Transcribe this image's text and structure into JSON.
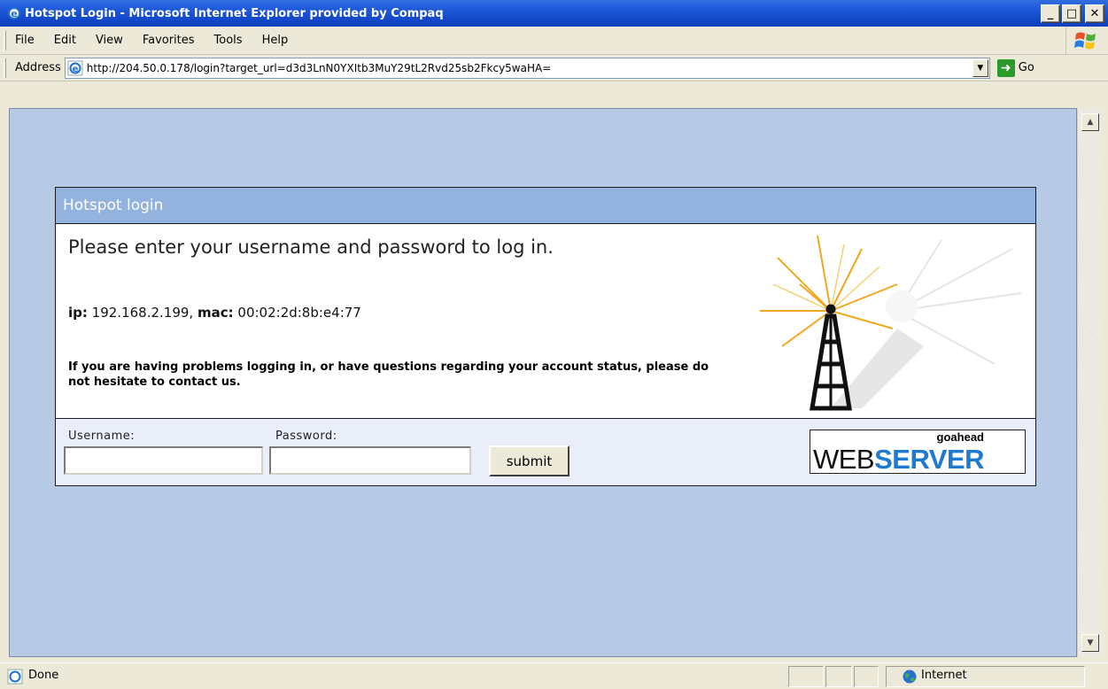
{
  "window": {
    "title": "Hotspot Login - Microsoft Internet Explorer provided by Compaq",
    "buttons": {
      "minimize": "_",
      "maximize": "□",
      "close": "✕"
    }
  },
  "menu": {
    "items": [
      "File",
      "Edit",
      "View",
      "Favorites",
      "Tools",
      "Help"
    ]
  },
  "address": {
    "label": "Address",
    "url": "http://204.50.0.178/login?target_url=d3d3LnN0YXItb3MuY29tL2Rvd25sb2Fkcy5waHA=",
    "go_label": "Go"
  },
  "page": {
    "panel_title": "Hotspot login",
    "prompt": "Please enter your username and password to log in.",
    "ip_label": "ip:",
    "ip_value": "192.168.2.199,",
    "mac_label": "mac:",
    "mac_value": "00:02:2d:8b:e4:77",
    "help_text": "If you are having problems logging in, or have questions regarding your account status, please do not hesitate to contact us.",
    "form": {
      "username_label": "Username:",
      "username_value": "",
      "password_label": "Password:",
      "password_value": "",
      "submit_label": "submit"
    },
    "logo": {
      "small": "goahead",
      "web": "WEB",
      "server": "SERVER"
    }
  },
  "status": {
    "text": "Done",
    "zone": "Internet"
  },
  "colors": {
    "titlebar": "#1c56d6",
    "page_background": "#b6cae6",
    "panel_header": "#93b2dd",
    "form_background": "#e9eef8",
    "logo_server": "#1c7ad0"
  },
  "icons": [
    "ie-icon",
    "windows-flag-icon",
    "go-arrow-icon",
    "globe-icon",
    "radio-tower-icon"
  ]
}
